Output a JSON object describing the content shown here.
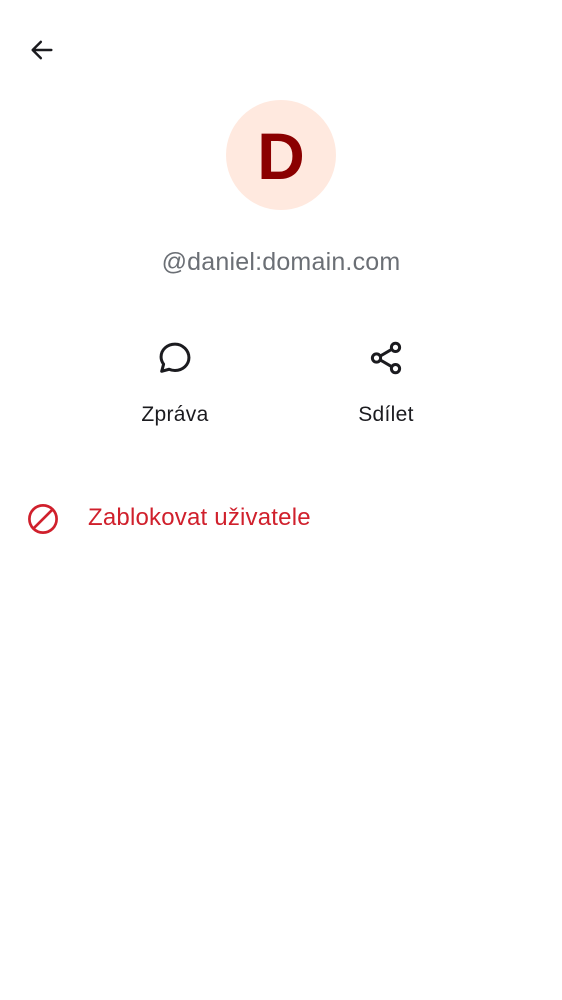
{
  "header": {
    "back_icon": "arrow-left-icon"
  },
  "profile": {
    "avatar_letter": "D",
    "user_id": "@daniel:domain.com"
  },
  "actions": [
    {
      "icon": "chat-bubble-icon",
      "label": "Zpráva"
    },
    {
      "icon": "share-icon",
      "label": "Sdílet"
    }
  ],
  "block": {
    "icon": "block-icon",
    "label": "Zablokovat uživatele"
  },
  "colors": {
    "background": "#ffffff",
    "avatar_bg": "#ffe9df",
    "avatar_letter": "#8b0000",
    "user_id_text": "#6b6f75",
    "icon": "#1b1b1f",
    "action_label": "#1b1b1f",
    "danger": "#d0202c"
  }
}
